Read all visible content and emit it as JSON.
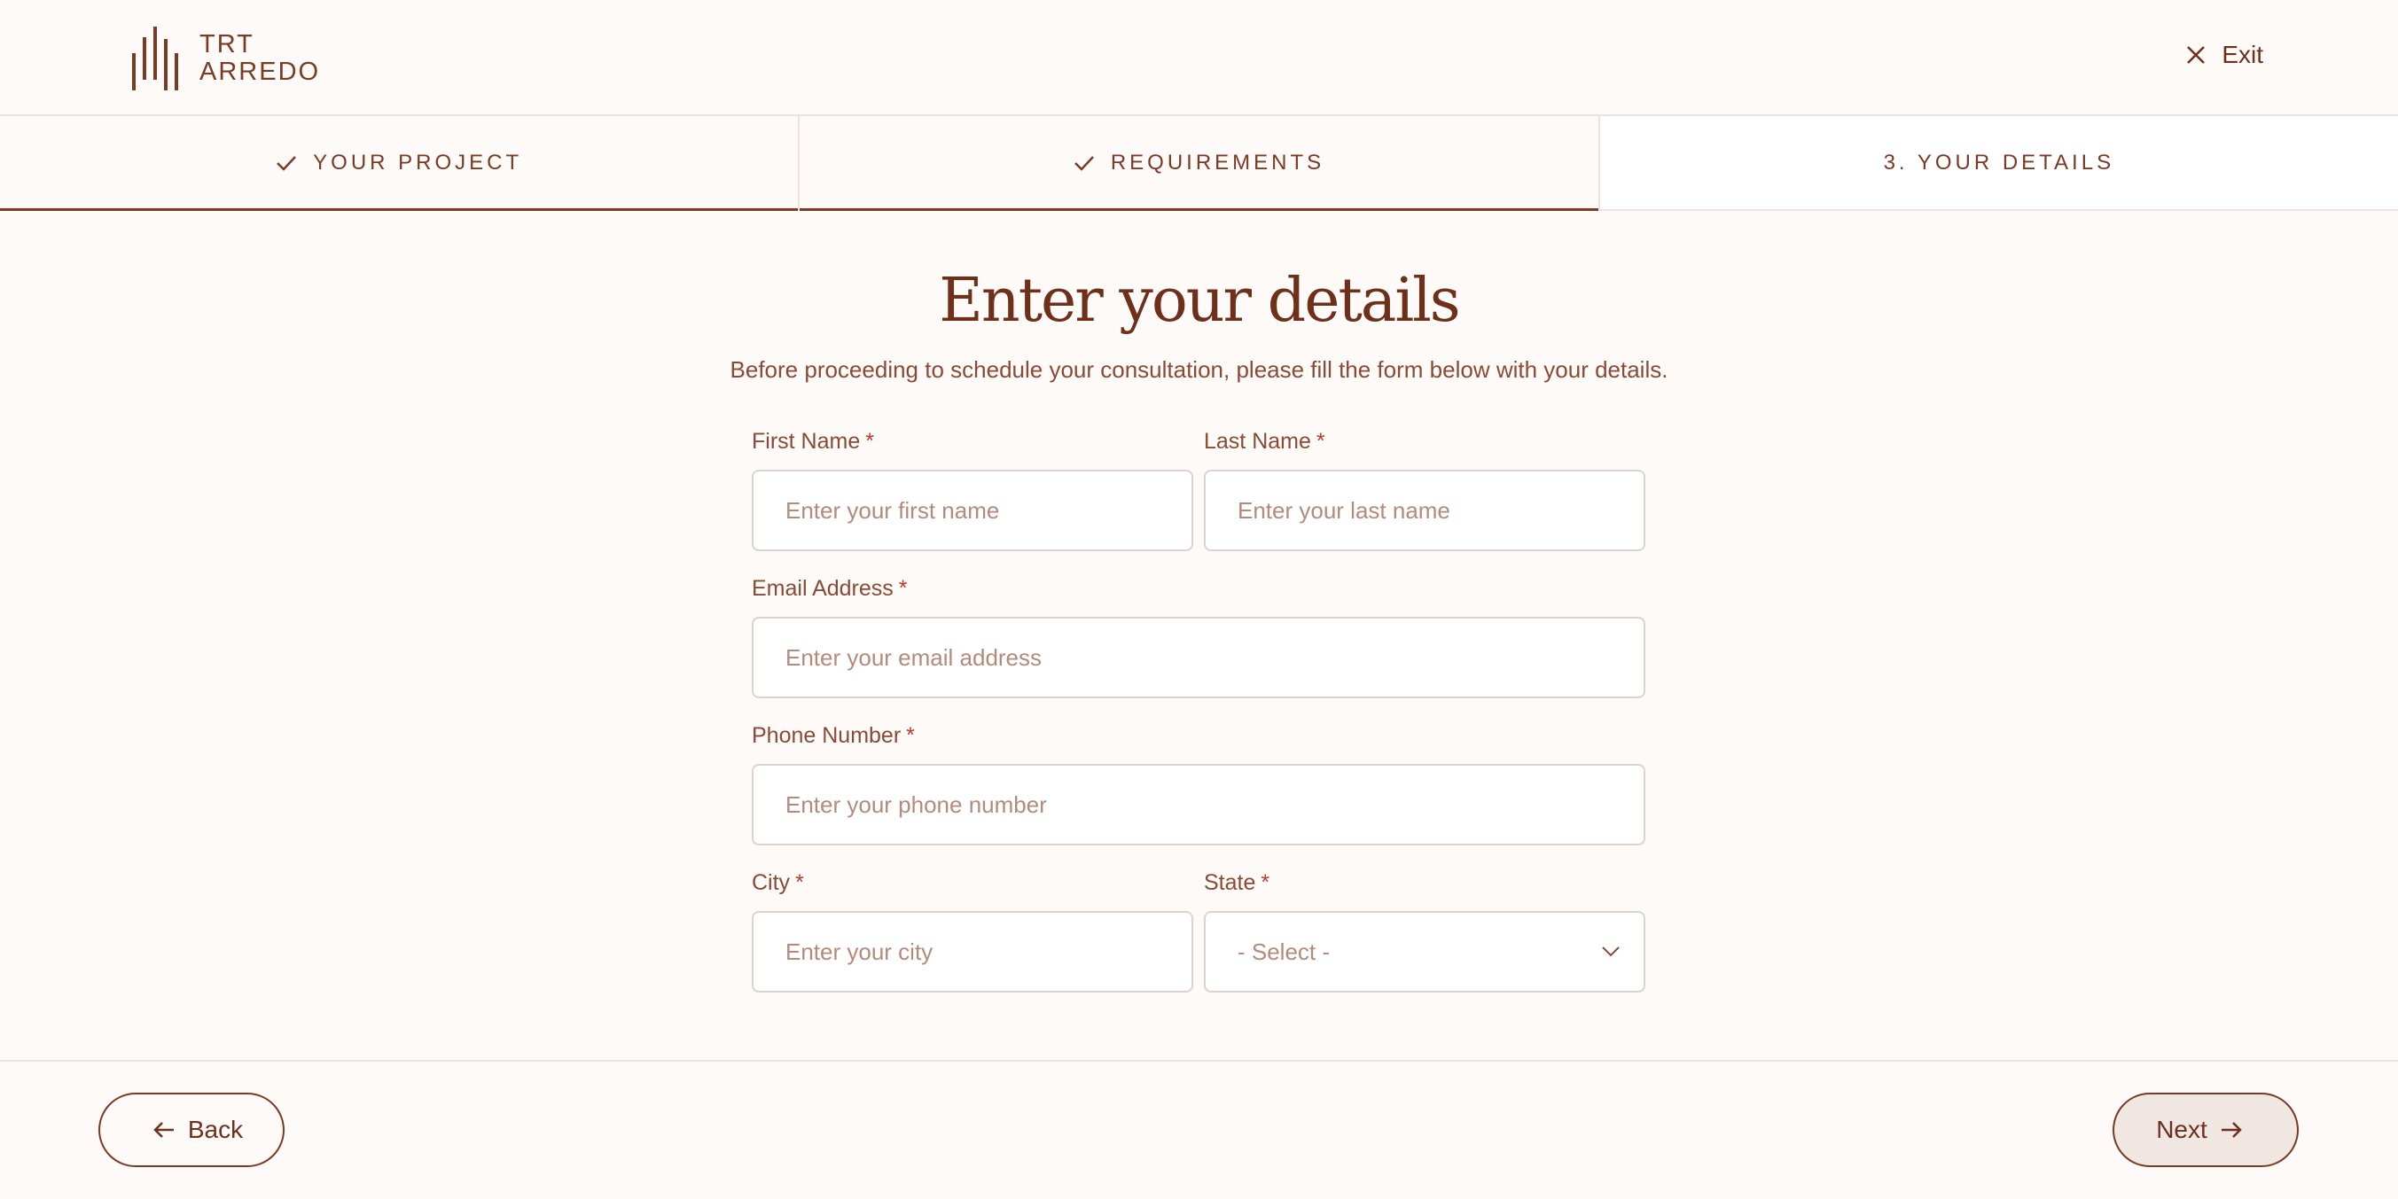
{
  "brand": {
    "line1": "TRT",
    "line2": "ARREDO"
  },
  "header": {
    "exit_label": "Exit"
  },
  "steps": [
    {
      "label": "YOUR PROJECT",
      "status": "done"
    },
    {
      "label": "REQUIREMENTS",
      "status": "done"
    },
    {
      "label": "3. YOUR DETAILS",
      "status": "current"
    }
  ],
  "page": {
    "title": "Enter your details",
    "subtitle": "Before proceeding to schedule your consultation, please fill the form below with your details."
  },
  "form": {
    "required_mark": "*",
    "first_name": {
      "label": "First Name",
      "placeholder": "Enter your first name",
      "value": ""
    },
    "last_name": {
      "label": "Last Name",
      "placeholder": "Enter your last name",
      "value": ""
    },
    "email": {
      "label": "Email Address",
      "placeholder": "Enter your email address",
      "value": ""
    },
    "phone": {
      "label": "Phone Number",
      "placeholder": "Enter your phone number",
      "value": ""
    },
    "city": {
      "label": "City",
      "placeholder": "Enter your city",
      "value": ""
    },
    "state": {
      "label": "State",
      "selected": "- Select -"
    }
  },
  "footer": {
    "back_label": "Back",
    "next_label": "Next"
  },
  "colors": {
    "brand": "#7a3a24",
    "background": "#fdfaf7",
    "required": "#c0392b",
    "next_button_bg": "#f0e6e2"
  }
}
